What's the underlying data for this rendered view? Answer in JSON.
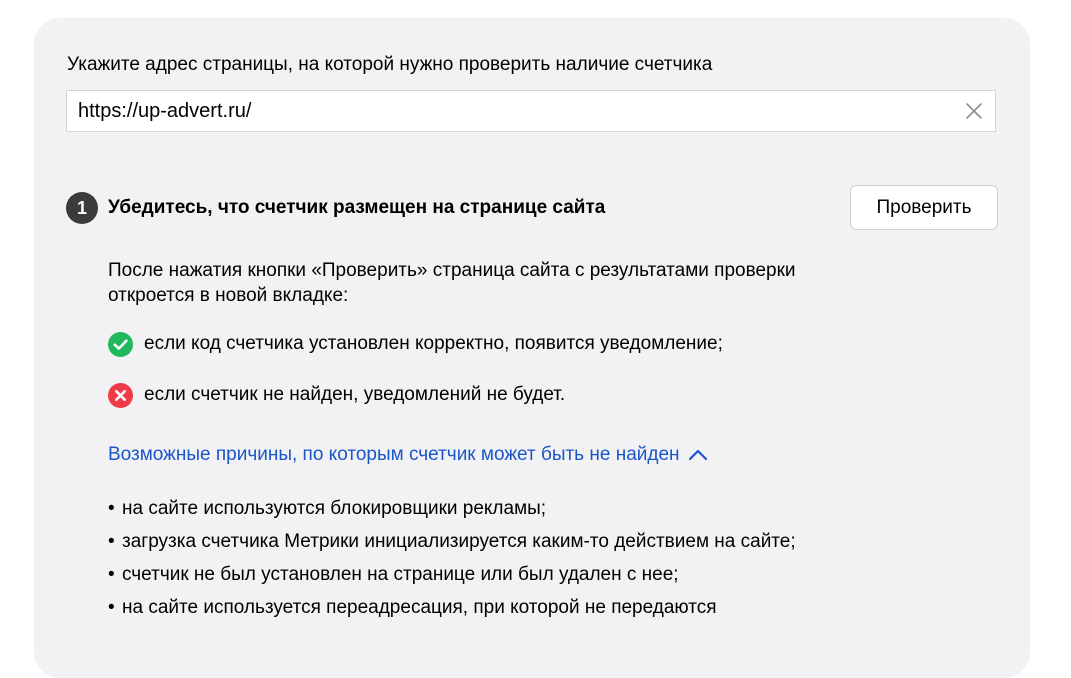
{
  "form": {
    "prompt": "Укажите адрес страницы, на которой нужно проверить наличие счетчика",
    "url_value": "https://up-advert.ru/"
  },
  "step": {
    "number": "1",
    "title": "Убедитесь, что счетчик размещен на странице сайта",
    "button_label": "Проверить",
    "description": "После нажатия кнопки «Проверить» страница сайта с результатами проверки откроется в новой вкладке:",
    "success_text": "если код счетчика установлен корректно, появится уведомление;",
    "error_text": "если счетчик не найден, уведомлений не будет."
  },
  "reasons": {
    "toggle_label": "Возможные причины, по которым счетчик может быть не найден",
    "items": [
      "на сайте используются блокировщики рекламы;",
      "загрузка счетчика Метрики инициализируется каким-то действием на сайте;",
      "счетчик не был установлен на странице или был удален с нее;",
      "на сайте используется переадресация, при которой не передаются"
    ]
  },
  "icons": {
    "clear": "close-icon",
    "success": "check-circle-icon",
    "error": "cross-circle-icon",
    "toggle": "chevron-up-icon"
  },
  "colors": {
    "panel_bg": "#f2f2f4",
    "success": "#1fb85a",
    "error": "#f03a47",
    "link": "#1a55c9",
    "step_badge": "#3b3b3d"
  }
}
